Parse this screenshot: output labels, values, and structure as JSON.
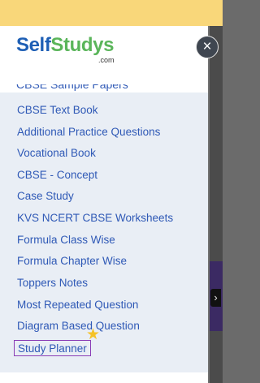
{
  "logo": {
    "brand_part1": "Self",
    "brand_part2": "Studys",
    "brand_suffix": ".com"
  },
  "close_button": {
    "symbol": "×"
  },
  "menu": {
    "items": [
      {
        "label": "CBSE Text Book"
      },
      {
        "label": "Additional Practice Questions"
      },
      {
        "label": "Vocational Book"
      },
      {
        "label": "CBSE - Concept"
      },
      {
        "label": "Case Study"
      },
      {
        "label": "KVS NCERT CBSE Worksheets"
      },
      {
        "label": "Formula Class Wise"
      },
      {
        "label": "Formula Chapter Wise"
      },
      {
        "label": "Toppers Notes"
      },
      {
        "label": "Most Repeated Question"
      },
      {
        "label": "Diagram Based Question"
      },
      {
        "label": "Study Planner"
      }
    ]
  },
  "background": {
    "arrow_symbol": "›"
  },
  "colors": {
    "accent_blue": "#2f59b6",
    "brand_green": "#5ab55a",
    "top_bar": "#f9d77a",
    "selection_border": "#8a3db6"
  },
  "icons": {
    "close": "close-icon",
    "star": "star-icon"
  }
}
